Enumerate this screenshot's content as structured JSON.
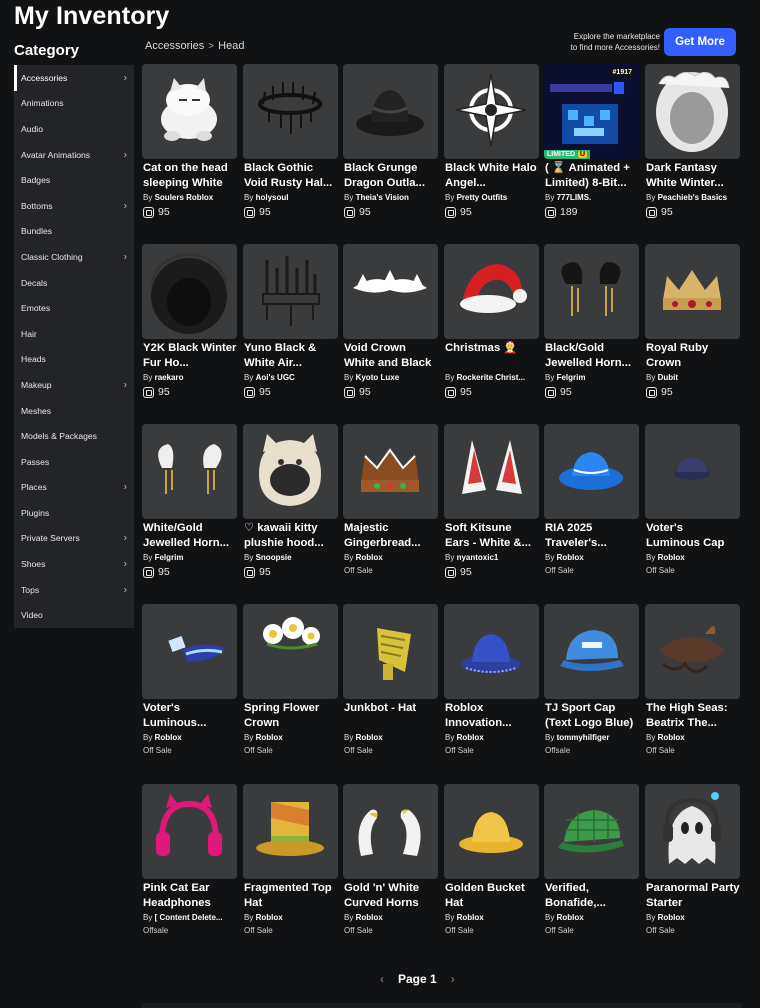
{
  "title": "My Inventory",
  "category_title": "Category",
  "categories": [
    {
      "label": "Accessories",
      "chevron": true,
      "active": true
    },
    {
      "label": "Animations",
      "chevron": false
    },
    {
      "label": "Audio",
      "chevron": false
    },
    {
      "label": "Avatar Animations",
      "chevron": true
    },
    {
      "label": "Badges",
      "chevron": false
    },
    {
      "label": "Bottoms",
      "chevron": true
    },
    {
      "label": "Bundles",
      "chevron": false
    },
    {
      "label": "Classic Clothing",
      "chevron": true
    },
    {
      "label": "Decals",
      "chevron": false
    },
    {
      "label": "Emotes",
      "chevron": false
    },
    {
      "label": "Hair",
      "chevron": false
    },
    {
      "label": "Heads",
      "chevron": false
    },
    {
      "label": "Makeup",
      "chevron": true
    },
    {
      "label": "Meshes",
      "chevron": false
    },
    {
      "label": "Models & Packages",
      "chevron": false
    },
    {
      "label": "Passes",
      "chevron": false
    },
    {
      "label": "Places",
      "chevron": true
    },
    {
      "label": "Plugins",
      "chevron": false
    },
    {
      "label": "Private Servers",
      "chevron": true
    },
    {
      "label": "Shoes",
      "chevron": true
    },
    {
      "label": "Tops",
      "chevron": true
    },
    {
      "label": "Video",
      "chevron": false
    }
  ],
  "breadcrumb": {
    "parent": "Accessories",
    "separator": ">",
    "current": "Head"
  },
  "explore": {
    "line1": "Explore the marketplace",
    "line2": "to find more Accessories!"
  },
  "get_more_label": "Get More",
  "items": [
    {
      "name": "Cat on the head sleeping White",
      "by": "By",
      "creator": "Soulers Roblox",
      "price": "95",
      "icon": "cat-hat"
    },
    {
      "name": "Black Gothic Void Rusty Hal...",
      "by": "By",
      "creator": "holysoul",
      "price": "95",
      "icon": "halo"
    },
    {
      "name": "Black Grunge Dragon Outla...",
      "by": "By",
      "creator": "Theia's Vision",
      "price": "95",
      "icon": "black-hat"
    },
    {
      "name": "Black White Halo Angel...",
      "by": "By",
      "creator": "Pretty Outfits",
      "price": "95",
      "icon": "star-halo"
    },
    {
      "name": "( ⌛ Animated + Limited) 8-Bit...",
      "by": "By",
      "creator": "777LIMS.",
      "price": "189",
      "icon": "8bit",
      "serial": "#1917",
      "limited": "LIMITED",
      "limited_u": "U"
    },
    {
      "name": "Dark Fantasy White Winter...",
      "by": "By",
      "creator": "Peachieb's Basics",
      "price": "95",
      "icon": "white-hood"
    },
    {
      "name": "Y2K Black Winter Fur Ho...",
      "by": "By",
      "creator": "raekaro",
      "price": "95",
      "icon": "black-hood"
    },
    {
      "name": "Yuno Black & White Air...",
      "by": "By",
      "creator": "Aoi's UGC",
      "price": "95",
      "icon": "spike-crown"
    },
    {
      "name": "Void Crown White and Black",
      "by": "By",
      "creator": "Kyoto Luxe",
      "price": "95",
      "icon": "void-crown"
    },
    {
      "name": "Christmas 🤶",
      "by": "By",
      "creator": "Rockerite Christ...",
      "price": "95",
      "icon": "santa-hat"
    },
    {
      "name": "Black/Gold Jewelled Horn...",
      "by": "By",
      "creator": "Felgrim",
      "price": "95",
      "icon": "black-horns"
    },
    {
      "name": "Royal Ruby Crown",
      "by": "By",
      "creator": "Dubit",
      "price": "95",
      "icon": "gold-crown"
    },
    {
      "name": "White/Gold Jewelled Horn...",
      "by": "By",
      "creator": "Felgrim",
      "price": "95",
      "icon": "white-horns"
    },
    {
      "name": "♡ kawaii kitty plushie hood...",
      "by": "By",
      "creator": "Snoopsie",
      "price": "95",
      "icon": "kitty-hood"
    },
    {
      "name": "Majestic Gingerbread...",
      "by": "By",
      "creator": "Roblox",
      "offsale": "Off Sale",
      "icon": "ginger-crown"
    },
    {
      "name": "Soft Kitsune Ears - White &...",
      "by": "By",
      "creator": "nyantoxic1",
      "price": "95",
      "icon": "kitsune-ears"
    },
    {
      "name": "RIA 2025 Traveler's...",
      "by": "By",
      "creator": "Roblox",
      "offsale": "Off Sale",
      "icon": "blue-cowboy"
    },
    {
      "name": "Voter's Luminous Cap",
      "by": "By",
      "creator": "Roblox",
      "offsale": "Off Sale",
      "icon": "dark-cap"
    },
    {
      "name": "Voter's Luminous...",
      "by": "By",
      "creator": "Roblox",
      "offsale": "Off Sale",
      "icon": "lum-visor"
    },
    {
      "name": "Spring Flower Crown",
      "by": "By",
      "creator": "Roblox",
      "offsale": "Off Sale",
      "icon": "flower-crown"
    },
    {
      "name": "Junkbot - Hat",
      "by": "By",
      "creator": "Roblox",
      "offsale": "Off Sale",
      "icon": "junkbot"
    },
    {
      "name": "Roblox Innovation...",
      "by": "By",
      "creator": "Roblox",
      "offsale": "Off Sale",
      "icon": "blue-bucket"
    },
    {
      "name": "TJ Sport Cap (Text Logo Blue)",
      "by": "By",
      "creator": "tommyhilfiger",
      "offsale": "Offsale",
      "icon": "sport-cap"
    },
    {
      "name": "The High Seas: Beatrix The...",
      "by": "By",
      "creator": "Roblox",
      "offsale": "Off Sale",
      "icon": "pirate-hat"
    },
    {
      "name": "Pink Cat Ear Headphones",
      "by": "By",
      "creator": "[ Content Delete...",
      "offsale": "Offsale",
      "icon": "pink-headphones"
    },
    {
      "name": "Fragmented Top Hat",
      "by": "By",
      "creator": "Roblox",
      "offsale": "Off Sale",
      "icon": "top-hat"
    },
    {
      "name": "Gold 'n' White Curved Horns",
      "by": "By",
      "creator": "Roblox",
      "offsale": "Off Sale",
      "icon": "curved-horns"
    },
    {
      "name": "Golden Bucket Hat",
      "by": "By",
      "creator": "Roblox",
      "offsale": "Off Sale",
      "icon": "gold-bucket"
    },
    {
      "name": "Verified, Bonafide,...",
      "by": "By",
      "creator": "Roblox",
      "offsale": "Off Sale",
      "icon": "green-cap"
    },
    {
      "name": "Paranormal Party Starter",
      "by": "By",
      "creator": "Roblox",
      "offsale": "Off Sale",
      "icon": "ghost"
    }
  ],
  "pager": {
    "prev": "‹",
    "label": "Page 1",
    "next": "›"
  }
}
